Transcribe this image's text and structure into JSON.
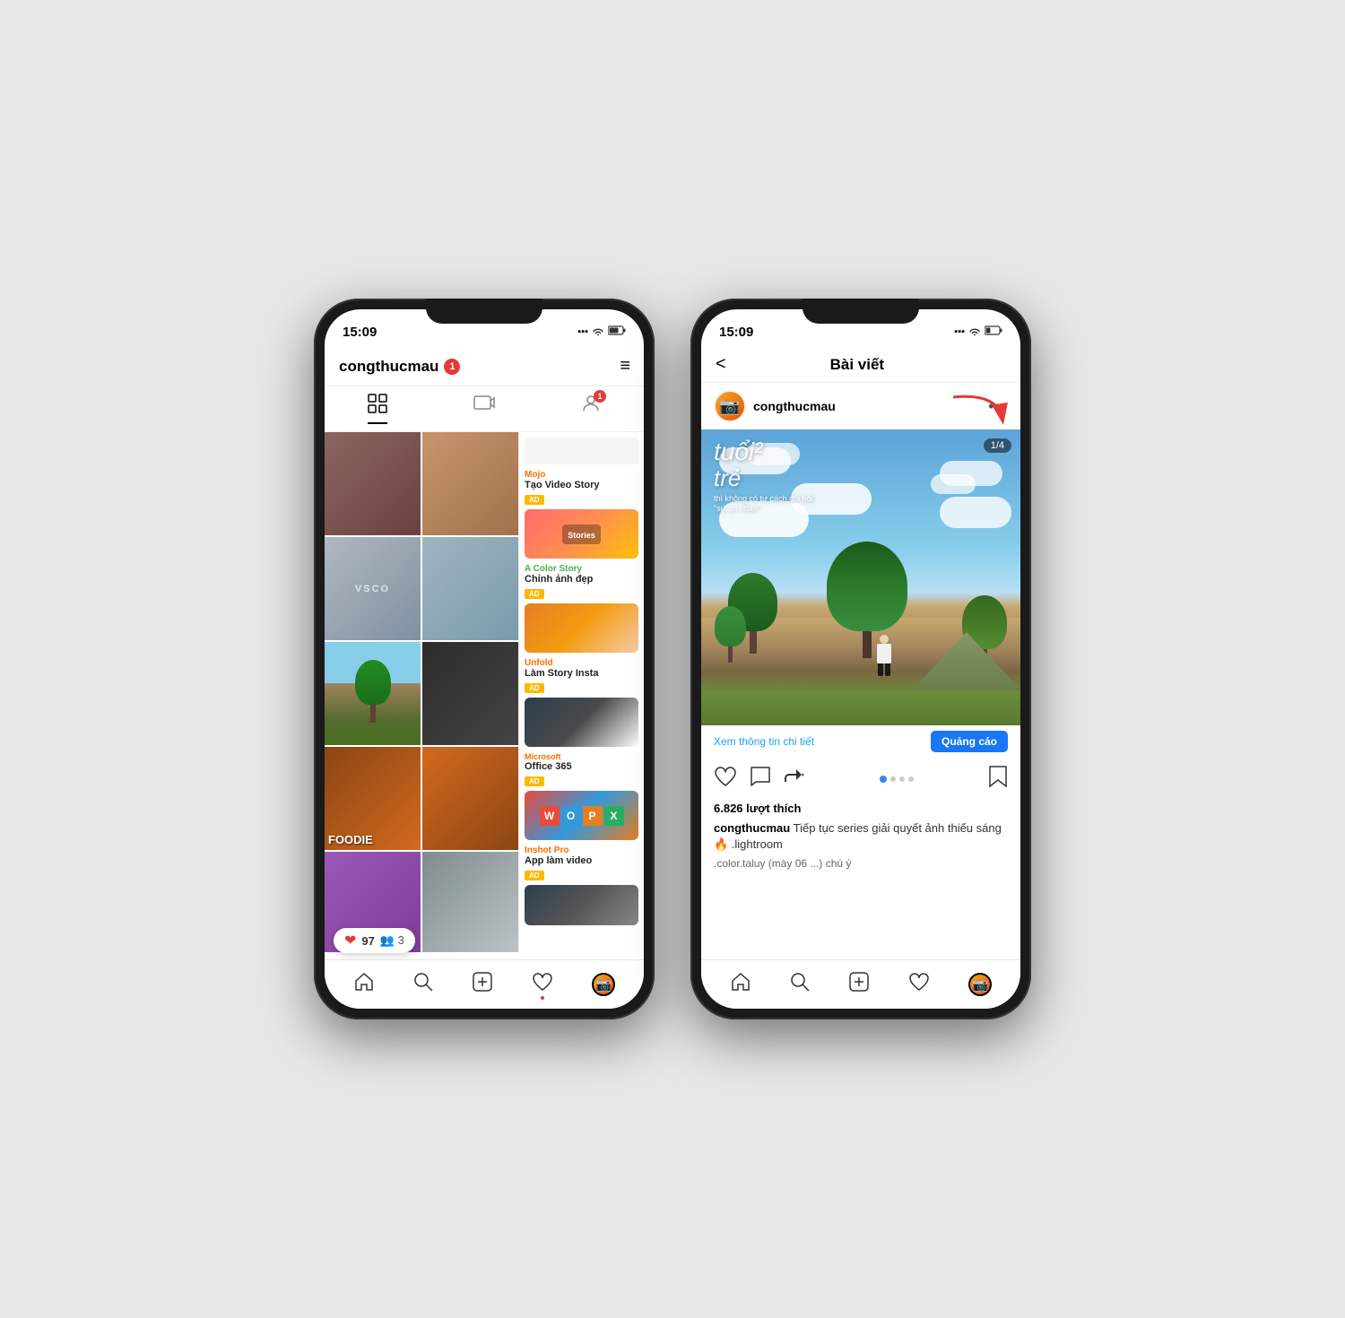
{
  "left_phone": {
    "status_bar": {
      "time": "15:09",
      "signal": "●●●",
      "wifi": "wifi",
      "battery": "battery"
    },
    "header": {
      "username": "congthucmau",
      "notification_count": "1",
      "menu_icon": "≡"
    },
    "tabs": {
      "grid_icon": "⊞",
      "tv_icon": "📺",
      "person_icon": "👤",
      "badge": "1"
    },
    "ads": [
      {
        "brand": "Mojo",
        "brand_color": "orange",
        "name": "Tạo Video Story",
        "badge": "AD",
        "thumb_class": "ad-thumb-mojo"
      },
      {
        "brand": "A Color Story",
        "brand_color": "green",
        "name": "Chỉnh ảnh đẹp",
        "badge": "AD",
        "thumb_class": "ad-thumb-color"
      },
      {
        "brand": "Unfold",
        "brand_color": "orange",
        "name": "Làm Story Insta",
        "badge": "AD",
        "thumb_class": "ad-thumb-unfold"
      },
      {
        "brand": "Microsoft",
        "brand_color": "microsoft",
        "name": "Office 365",
        "badge": "AD",
        "thumb_class": "ad-thumb-office"
      },
      {
        "brand": "Inshot Pro",
        "brand_color": "inshot",
        "name": "App làm video",
        "badge": "AD",
        "thumb_class": "ad-thumb-inshot"
      }
    ],
    "notification": {
      "heart": "❤",
      "count": "97",
      "people": "👥 3"
    },
    "bottom_nav": {
      "home": "⌂",
      "search": "🔍",
      "add": "＋",
      "heart": "♡",
      "avatar": "📷"
    }
  },
  "right_phone": {
    "status_bar": {
      "time": "15:09",
      "signal": "●●●",
      "wifi": "wifi",
      "battery": "battery"
    },
    "header": {
      "back": "<",
      "title": "Bài viết"
    },
    "post": {
      "username": "congthucmau",
      "avatar": "📷",
      "text_overlay_line1": "tuổi",
      "text_overlay_line2": "trẻ",
      "text_overlay_sub": "thi không có tư cách đòi hỏi",
      "text_overlay_sub2": "\"sự an nhàn\"",
      "counter": "1/4",
      "likes": "6.826 lượt thích",
      "caption_user": "congthucmau",
      "caption": "Tiếp tục series giải quyết ảnh thiếu sáng 🔥 .lightroom",
      "caption_more": ".color.taluy (mày 06 ...) chú ý",
      "ad_text": "Xem thông tin chi tiết",
      "ad_btn": "Quảng cáo"
    },
    "bottom_nav": {
      "home": "⌂",
      "search": "🔍",
      "add": "＋",
      "heart": "♡",
      "avatar": "📷"
    }
  }
}
